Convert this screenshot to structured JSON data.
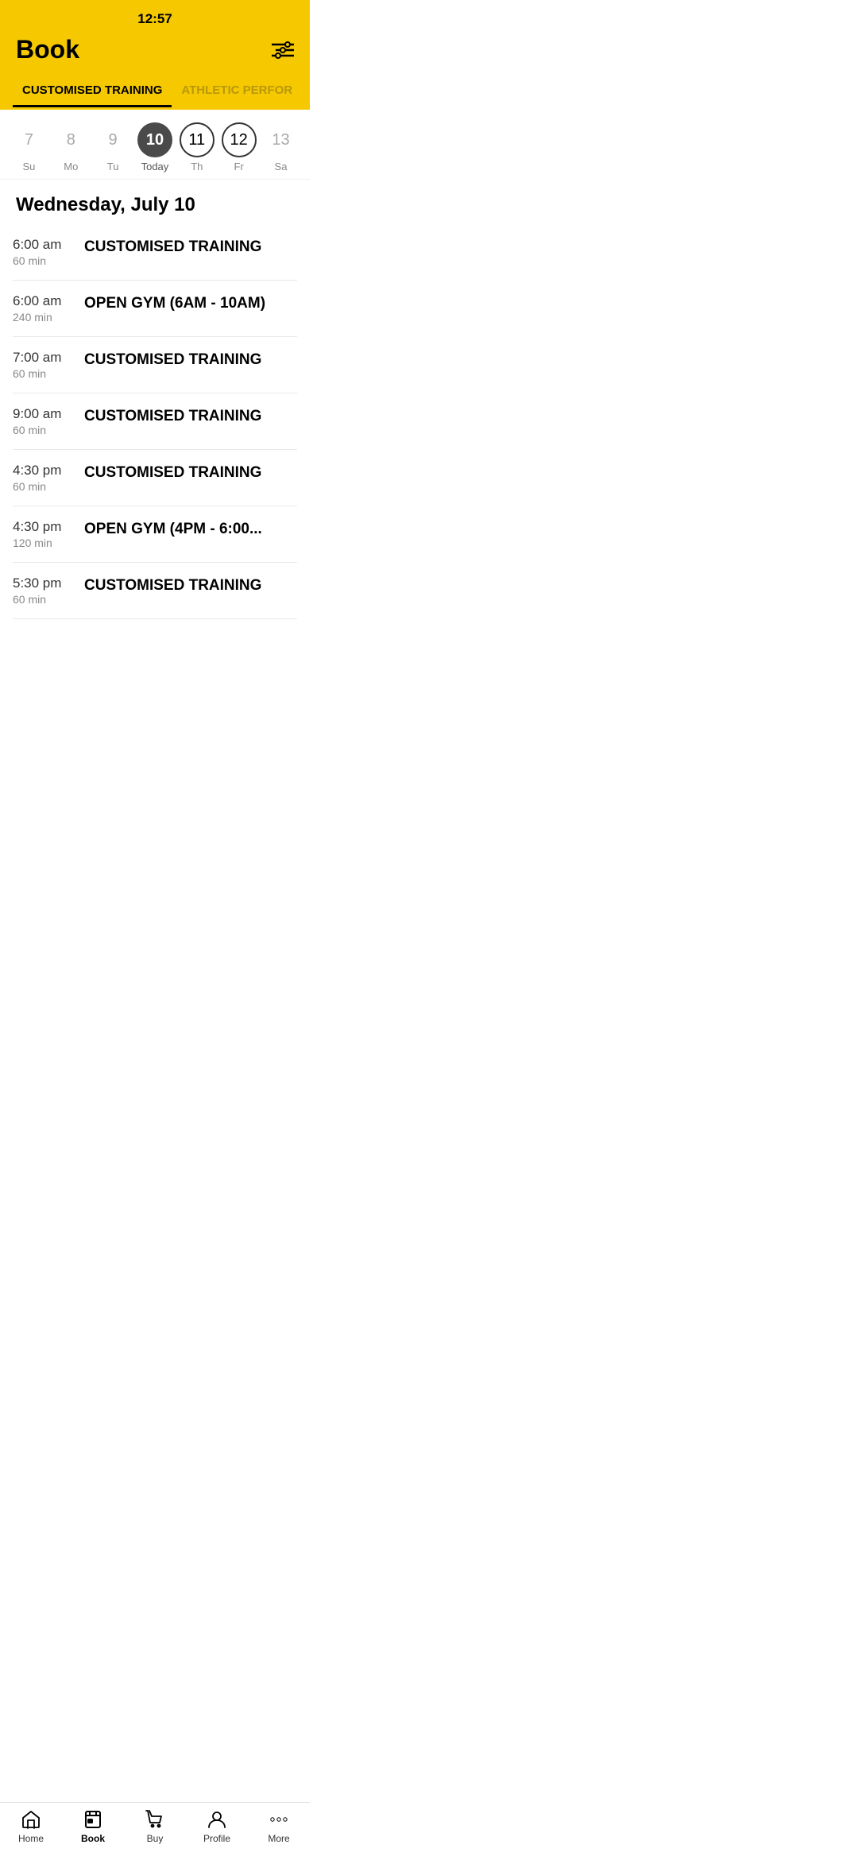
{
  "statusBar": {
    "time": "12:57"
  },
  "header": {
    "title": "Book",
    "filterIconLabel": "filter-icon"
  },
  "categoryTabs": [
    {
      "label": "CUSTOMISED TRAINING",
      "active": true
    },
    {
      "label": "ATHLETIC PERFOR",
      "active": false
    }
  ],
  "calendar": {
    "days": [
      {
        "number": "7",
        "name": "Su",
        "state": "plain"
      },
      {
        "number": "8",
        "name": "Mo",
        "state": "plain"
      },
      {
        "number": "9",
        "name": "Tu",
        "state": "plain"
      },
      {
        "number": "10",
        "name": "Today",
        "state": "selected"
      },
      {
        "number": "11",
        "name": "Th",
        "state": "outlined"
      },
      {
        "number": "12",
        "name": "Fr",
        "state": "outlined"
      },
      {
        "number": "13",
        "name": "Sa",
        "state": "plain"
      }
    ]
  },
  "dateHeading": "Wednesday, July 10",
  "schedule": [
    {
      "time": "6:00 am",
      "duration": "60 min",
      "className": "CUSTOMISED TRAINING"
    },
    {
      "time": "6:00 am",
      "duration": "240 min",
      "className": "OPEN GYM (6AM - 10AM)"
    },
    {
      "time": "7:00 am",
      "duration": "60 min",
      "className": "CUSTOMISED TRAINING"
    },
    {
      "time": "9:00 am",
      "duration": "60 min",
      "className": "CUSTOMISED TRAINING"
    },
    {
      "time": "4:30 pm",
      "duration": "60 min",
      "className": "CUSTOMISED TRAINING"
    },
    {
      "time": "4:30 pm",
      "duration": "120 min",
      "className": "OPEN GYM (4PM - 6:00..."
    },
    {
      "time": "5:30 pm",
      "duration": "60 min",
      "className": "CUSTOMISED TRAINING"
    }
  ],
  "bottomNav": [
    {
      "id": "home",
      "label": "Home",
      "icon": "home-icon",
      "active": false
    },
    {
      "id": "book",
      "label": "Book",
      "icon": "book-icon",
      "active": true
    },
    {
      "id": "buy",
      "label": "Buy",
      "icon": "buy-icon",
      "active": false
    },
    {
      "id": "profile",
      "label": "Profile",
      "icon": "profile-icon",
      "active": false
    },
    {
      "id": "more",
      "label": "More",
      "icon": "more-icon",
      "active": false
    }
  ]
}
